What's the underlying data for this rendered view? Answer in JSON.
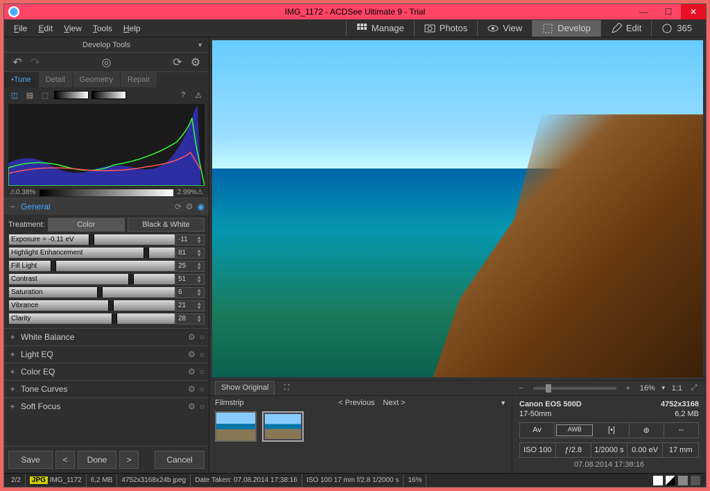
{
  "window": {
    "title": "IMG_1172 - ACDSee Ultimate 9 - Trial"
  },
  "menu": {
    "file": "File",
    "edit": "Edit",
    "view": "View",
    "tools": "Tools",
    "help": "Help"
  },
  "modes": {
    "manage": "Manage",
    "photos": "Photos",
    "view": "View",
    "develop": "Develop",
    "edit": "Edit",
    "threesixtyfive": "365"
  },
  "sidebar": {
    "title": "Develop Tools",
    "tabs": {
      "tune": "Tune",
      "detail": "Detail",
      "geometry": "Geometry",
      "repair": "Repair"
    },
    "clip_low": "0.38%",
    "clip_high": "2.99%",
    "general": {
      "title": "General",
      "treatment_label": "Treatment:",
      "color": "Color",
      "bw": "Black & White",
      "sliders": [
        {
          "label": "Exposure = -0.11 eV",
          "val": "-11",
          "pos": 48
        },
        {
          "label": "Highlight Enhancement",
          "val": "81",
          "pos": 81
        },
        {
          "label": "Fill Light",
          "val": "25",
          "pos": 25
        },
        {
          "label": "Contrast",
          "val": "51",
          "pos": 72
        },
        {
          "label": "Saturation",
          "val": "6",
          "pos": 53
        },
        {
          "label": "Vibrance",
          "val": "21",
          "pos": 60
        },
        {
          "label": "Clarity",
          "val": "28",
          "pos": 62
        }
      ]
    },
    "sections": [
      "White Balance",
      "Light EQ",
      "Color EQ",
      "Tone Curves",
      "Soft Focus"
    ],
    "buttons": {
      "save": "Save",
      "done": "Done",
      "cancel": "Cancel"
    }
  },
  "viewer": {
    "show_original": "Show Original",
    "zoom": "16%",
    "onetoone": "1:1"
  },
  "filmstrip": {
    "title": "Filmstrip",
    "prev": "Previous",
    "next": "Next"
  },
  "exif": {
    "camera": "Canon EOS 500D",
    "dims": "4752x3168",
    "lens": "17-50mm",
    "size": "6,2 MB",
    "mode": "Av",
    "awb": "AWB",
    "dash": "--",
    "iso": "ISO 100",
    "fstop": "ƒ/2.8",
    "shutter": "1/2000 s",
    "ev": "0.00 eV",
    "focal": "17 mm",
    "date": "07.08.2014 17:38:16"
  },
  "status": {
    "count": "2/2",
    "badge": "JPG",
    "name": "IMG_1172",
    "filesize": "6,2 MB",
    "fmt": "4752x3168x24b jpeg",
    "taken": "Date Taken: 07.08.2014 17:38:16",
    "shot": "ISO 100   17 mm   f/2.8   1/2000 s",
    "zoom": "16%"
  }
}
